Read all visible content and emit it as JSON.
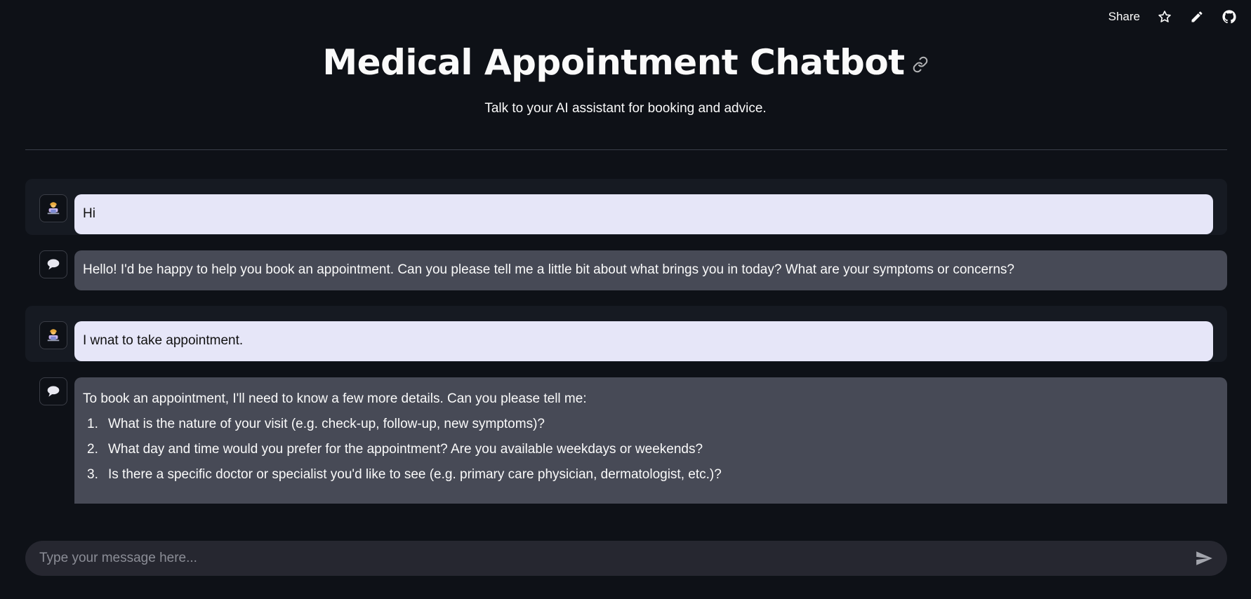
{
  "toolbar": {
    "share_label": "Share"
  },
  "header": {
    "title": "Medical Appointment Chatbot",
    "subtitle": "Talk to your AI assistant for booking and advice."
  },
  "messages": [
    {
      "role": "user",
      "text": "Hi"
    },
    {
      "role": "assistant",
      "text": "Hello! I'd be happy to help you book an appointment. Can you please tell me a little bit about what brings you in today? What are your symptoms or concerns?"
    },
    {
      "role": "user",
      "text": "I wnat to take appointment."
    },
    {
      "role": "assistant",
      "intro": "To book an appointment, I'll need to know a few more details. Can you please tell me:",
      "items": [
        {
          "num": "1.",
          "text": "What is the nature of your visit (e.g. check-up, follow-up, new symptoms)?"
        },
        {
          "num": "2.",
          "text": "What day and time would you prefer for the appointment? Are you available weekdays or weekends?"
        },
        {
          "num": "3.",
          "text": "Is there a specific doctor or specialist you'd like to see (e.g. primary care physician, dermatologist, etc.)?"
        }
      ]
    }
  ],
  "input": {
    "placeholder": "Type your message here..."
  },
  "icons": {
    "user_avatar": "person-at-computer-icon",
    "assistant_avatar": "speech-bubble-icon"
  }
}
